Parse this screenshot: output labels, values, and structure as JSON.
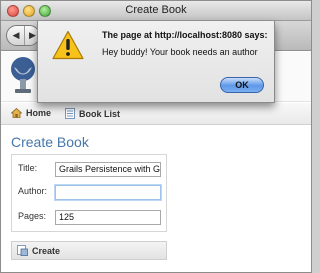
{
  "window": {
    "title": "Create Book"
  },
  "toolbar": {
    "back_icon": "back-arrow-icon",
    "forward_icon": "forward-arrow-icon"
  },
  "nav": {
    "home_label": "Home",
    "list_label": "Book List"
  },
  "page": {
    "title": "Create Book"
  },
  "form": {
    "fields": [
      {
        "label": "Title:",
        "value": "Grails Persistence with GC"
      },
      {
        "label": "Author:",
        "value": ""
      },
      {
        "label": "Pages:",
        "value": "125"
      }
    ],
    "create_label": "Create"
  },
  "dialog": {
    "title": "The page at http://localhost:8080 says:",
    "message": "Hey buddy! Your book needs an author",
    "ok_label": "OK",
    "icon": "warning-icon"
  },
  "colors": {
    "title_blue": "#4577a8",
    "ok_button": "#5e98e8",
    "warning_yellow": "#f7c21a"
  }
}
